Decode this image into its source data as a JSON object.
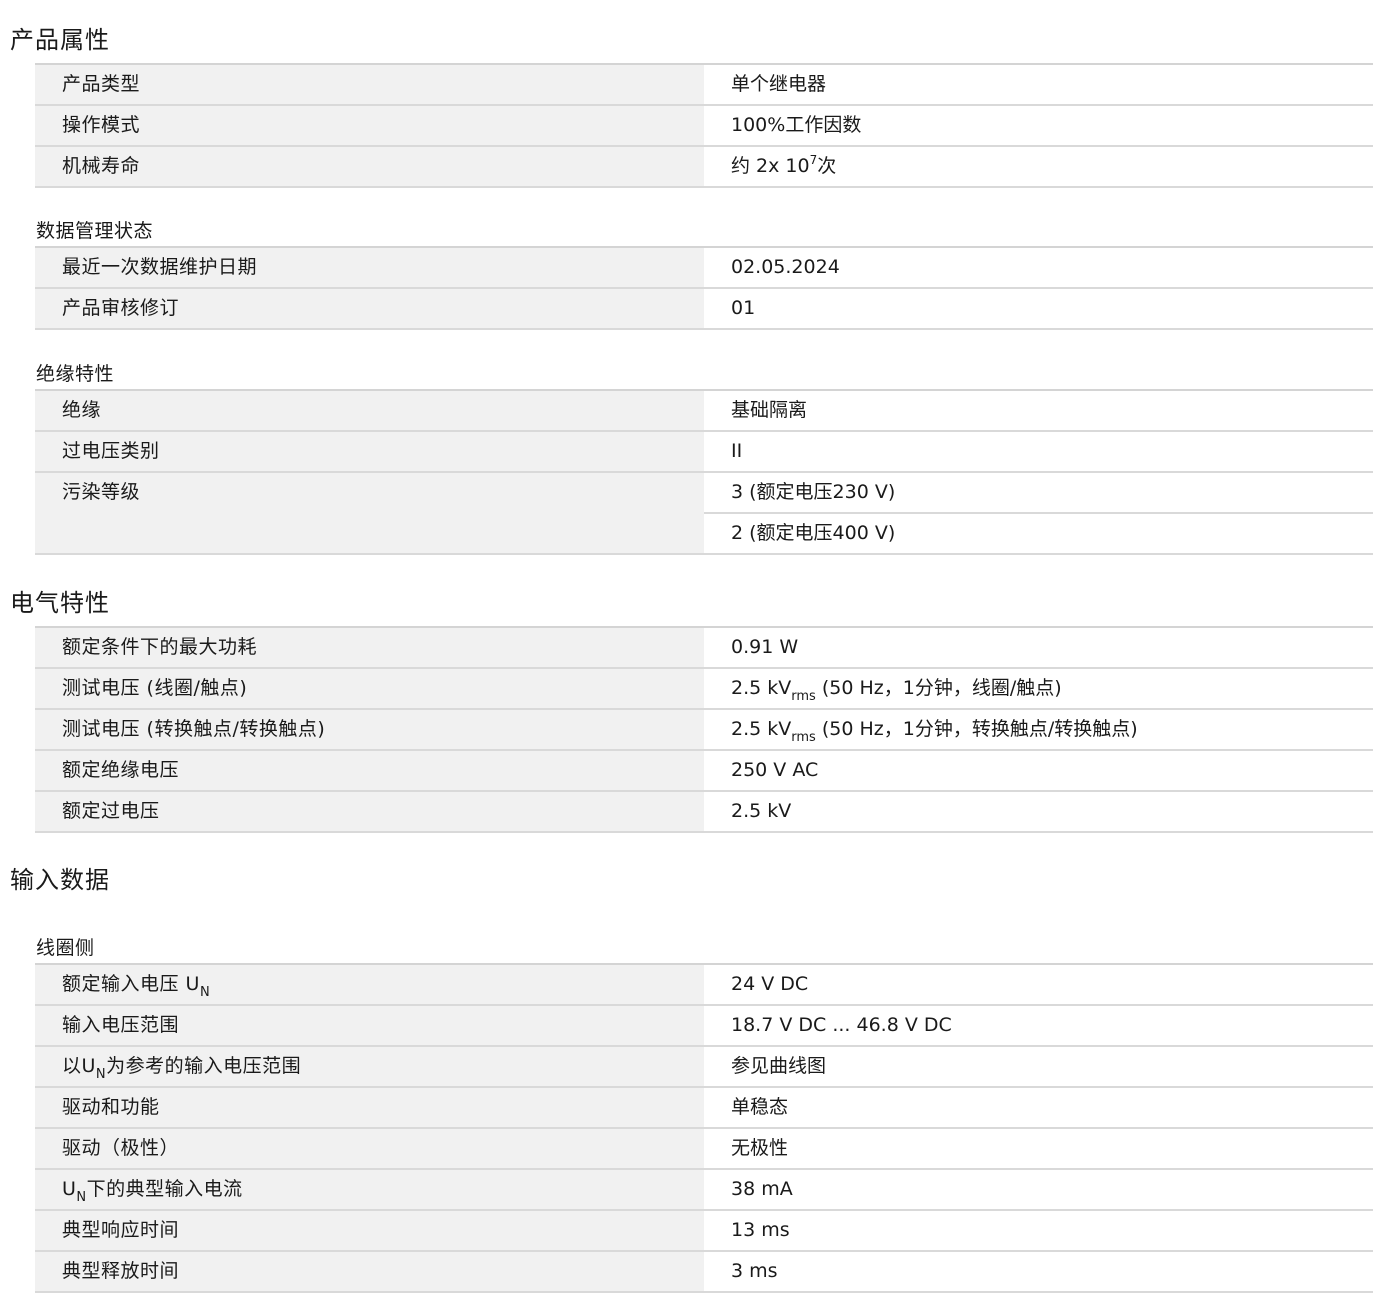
{
  "sections": {
    "product": {
      "title": "产品属性",
      "rows": [
        {
          "label": "产品类型",
          "value": "单个继电器"
        },
        {
          "label": "操作模式",
          "value": "100%工作因数"
        },
        {
          "label": "机械寿命",
          "value_pre": "约 2x 10",
          "value_sup": "7",
          "value_post": "次"
        }
      ],
      "data_mgmt": {
        "title": "数据管理状态",
        "rows": [
          {
            "label": "最近一次数据维护日期",
            "value": "02.05.2024"
          },
          {
            "label": "产品审核修订",
            "value": "01"
          }
        ]
      },
      "insulation": {
        "title": "绝缘特性",
        "rows": [
          {
            "label": "绝缘",
            "value": "基础隔离"
          },
          {
            "label": "过电压类别",
            "value": "II"
          },
          {
            "label": "污染等级",
            "value": "3 (额定电压230 V)"
          },
          {
            "label": "",
            "value": "2 (额定电压400 V)"
          }
        ]
      }
    },
    "electrical": {
      "title": "电气特性",
      "rows": [
        {
          "label": "额定条件下的最大功耗",
          "value": "0.91 W"
        },
        {
          "label": "测试电压 (线圈/触点)",
          "value_pre": "2.5 kV",
          "value_sub": "rms",
          "value_post": " (50 Hz，1分钟，线圈/触点)"
        },
        {
          "label": "测试电压 (转换触点/转换触点)",
          "value_pre": "2.5 kV",
          "value_sub": "rms",
          "value_post": " (50 Hz，1分钟，转换触点/转换触点)"
        },
        {
          "label": "额定绝缘电压",
          "value": "250 V AC"
        },
        {
          "label": "额定过电压",
          "value": "2.5 kV"
        }
      ]
    },
    "input": {
      "title": "输入数据",
      "coil": {
        "title": "线圈侧",
        "rows": [
          {
            "label_pre": "额定输入电压 U",
            "label_sub": "N",
            "label_post": "",
            "value": "24 V DC"
          },
          {
            "label": "输入电压范围",
            "value": "18.7 V DC ... 46.8 V DC"
          },
          {
            "label_pre": "以U",
            "label_sub": "N",
            "label_post": "为参考的输入电压范围",
            "value": "参见曲线图"
          },
          {
            "label": "驱动和功能",
            "value": "单稳态"
          },
          {
            "label": "驱动（极性）",
            "value": "无极性"
          },
          {
            "label_pre": "U",
            "label_sub": "N",
            "label_post": "下的典型输入电流",
            "value": "38 mA"
          },
          {
            "label": "典型响应时间",
            "value": "13 ms"
          },
          {
            "label": "典型释放时间",
            "value": "3 ms"
          }
        ]
      }
    }
  }
}
